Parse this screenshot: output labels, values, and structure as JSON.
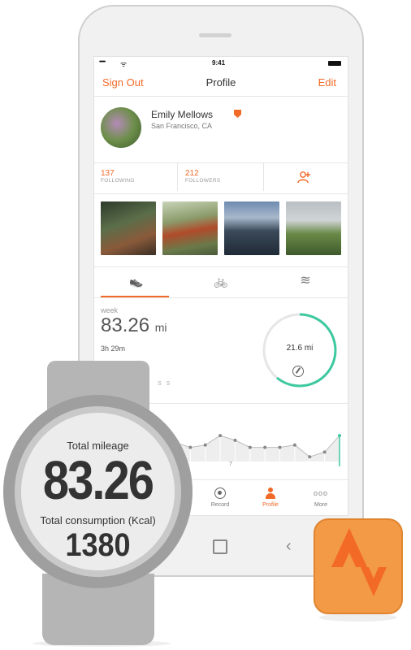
{
  "status_bar": {
    "signal": "•••••",
    "wifi": "ᯤ",
    "time": "9:41"
  },
  "nav": {
    "left": "Sign Out",
    "title": "Profile",
    "right": "Edit"
  },
  "profile": {
    "name": "Emily Mellows",
    "location": "San Francisco, CA"
  },
  "stats": [
    {
      "value": "137",
      "label": "FOLLOWING"
    },
    {
      "value": "212",
      "label": "FOLLOWERS"
    }
  ],
  "photos": [
    {
      "icon": "forest-trail-photo"
    },
    {
      "icon": "runner-legs-photo"
    },
    {
      "icon": "lake-landscape-photo"
    },
    {
      "icon": "green-hills-photo"
    }
  ],
  "tabs": [
    {
      "icon": "shoe-icon",
      "glyph": "👟"
    },
    {
      "icon": "bike-icon",
      "glyph": "🚲"
    },
    {
      "icon": "swim-icon",
      "glyph": "≋"
    }
  ],
  "activity": {
    "period": "week",
    "distance": "83.26",
    "unit": "mi",
    "duration": "3h 29m",
    "day_initials": "S  S",
    "ring_value": "21.6 mi"
  },
  "chart_data": {
    "type": "line",
    "x_label": "7",
    "values": [
      0.4,
      0.3,
      0.35,
      0.55,
      0.45,
      0.3,
      0.3,
      0.3,
      0.35,
      0.1,
      0.2,
      0.55
    ],
    "highlight_index": 11
  },
  "tab_bar": [
    {
      "label": "Record"
    },
    {
      "label": "Profile"
    },
    {
      "label": "More"
    }
  ],
  "watch": {
    "label1": "Total mileage",
    "value": "83.26",
    "label2": "Total consumption (Kcal)",
    "kcal": "1380"
  },
  "colors": {
    "accent": "#f26a26",
    "ring": "#3dc9a0",
    "badge": "#f39a46"
  }
}
